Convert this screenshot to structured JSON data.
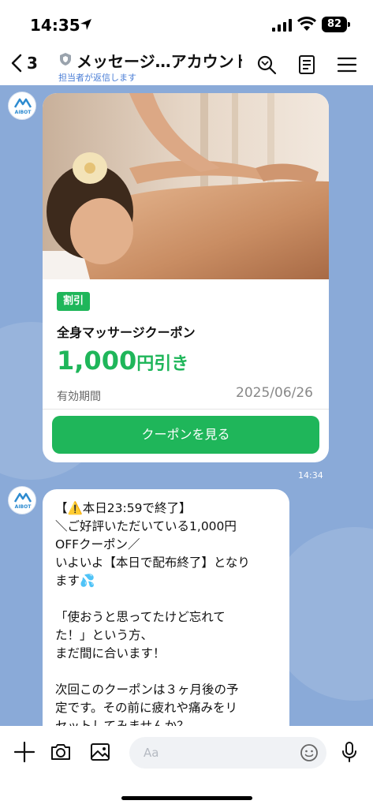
{
  "status_bar": {
    "time": "14:35",
    "battery": "82"
  },
  "header": {
    "back_count": "3",
    "title": "メッセージ…アカウント",
    "subtitle": "担当者が返信します"
  },
  "avatar_label": "AIBOT",
  "coupon": {
    "tag": "割引",
    "name": "全身マッサージクーポン",
    "amount_value": "1,000",
    "amount_unit": "円引き",
    "validity_label": "有効期間",
    "validity_date": "2025/06/26",
    "button_label": "クーポンを見る"
  },
  "timestamps": {
    "coupon_time": "14:34"
  },
  "message": {
    "lines": [
      "【⚠️本日23:59で終了】",
      "＼ご好評いただいている1,000円",
      "OFFクーポン／",
      "いよいよ【本日で配布終了】となり",
      "ます💦",
      "",
      "「使おうと思ってたけど忘れて",
      "た！」という方、",
      "まだ間に合います！",
      "",
      "次回このクーポンは３ヶ月後の予",
      "定です。その前に疲れや痛みをリ",
      "セットしてみませんか？"
    ]
  },
  "input": {
    "placeholder": "Aa"
  },
  "colors": {
    "brand_green": "#1fb65a",
    "chat_background": "#8aaad8",
    "link_blue": "#4a7ed6"
  }
}
